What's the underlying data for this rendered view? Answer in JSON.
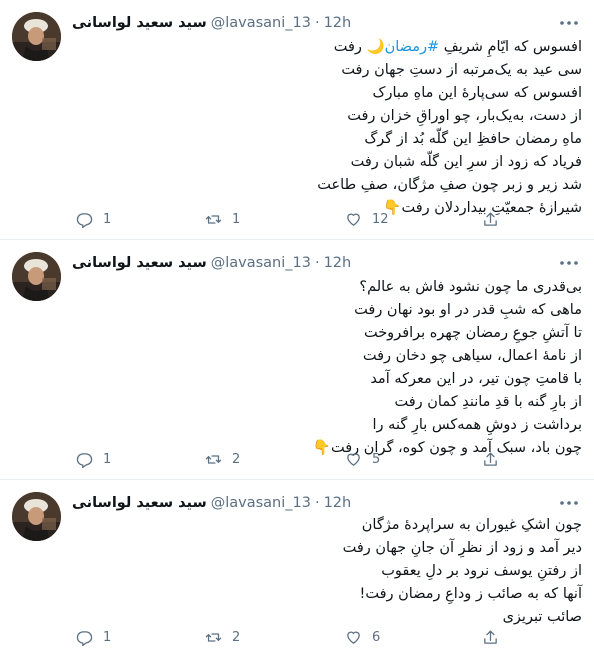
{
  "author": {
    "name": "سید سعید لواسانی",
    "handle": "@lavasani_13",
    "separator": "·"
  },
  "tweets": [
    {
      "time": "12h",
      "lines": [
        {
          "pre": "افسوس که ایّامِ شریفِ ",
          "tag": "#رمضان",
          "moon": "🌙",
          "post": " رفت"
        },
        {
          "text": "سی عید به یک‌مرتبه از دستِ جهان رفت"
        },
        {
          "text": "افسوس که سی‌پارهٔ این ماهِ مبارک"
        },
        {
          "text": "از دست، به‌یک‌بار، چو اوراقِ خزان رفت"
        },
        {
          "text": "ماهِ رمضان حافظِ این گلّه بُد از گرگ"
        },
        {
          "text": "فریاد که زود از سرِ این گلّه شبان رفت"
        },
        {
          "text": "شد زیر و زبر چون صفِ مژگان، صفِ طاعت"
        },
        {
          "text": "شیرازهٔ جمعیّتِ بیداردلان رفت",
          "emoji": "👇"
        }
      ],
      "replies": "1",
      "retweets": "1",
      "likes": "12"
    },
    {
      "time": "12h",
      "lines": [
        {
          "text": "بی‌قدری ما چون نشود فاش به عالم؟"
        },
        {
          "text": "ماهی که شبِ قدر در او بود نهان رفت"
        },
        {
          "text": "تا آتشِ جوعِ رمضان چهره برافروخت"
        },
        {
          "text": "از نامهٔ اعمال، سیاهی چو دخان رفت"
        },
        {
          "text": "با قامتِ چون تیر، در این معرکه آمد"
        },
        {
          "text": "از بارِ گنه با قدِ مانندِ کمان رفت"
        },
        {
          "text": "برداشت ز دوشِ همه‌کس بارِ گنه را"
        },
        {
          "text": "چون باد، سبک آمد و چون کوه، گران رفت",
          "emoji": "👇"
        }
      ],
      "replies": "1",
      "retweets": "2",
      "likes": "5"
    },
    {
      "time": "12h",
      "lines": [
        {
          "text": "چون اشکِ غیوران به سراپردهٔ مژگان"
        },
        {
          "text": "دیر آمد و زود از نظرِ آن جانِ جهان رفت"
        },
        {
          "text": "از رفتنِ یوسف نرود بر دلِ یعقوب"
        },
        {
          "text": "آنها که به صائب ز وداعِ رمضان رفت!"
        },
        {
          "text": "صائب تبریزی"
        }
      ],
      "replies": "1",
      "retweets": "2",
      "likes": "6"
    }
  ],
  "icons": {
    "more": "more-horizontal-icon",
    "reply": "reply-icon",
    "retweet": "retweet-icon",
    "like": "heart-icon",
    "share": "share-icon"
  },
  "colors": {
    "hashtag": "#1b95e0",
    "muted": "#5b7083",
    "divider": "#e6ecf0"
  }
}
